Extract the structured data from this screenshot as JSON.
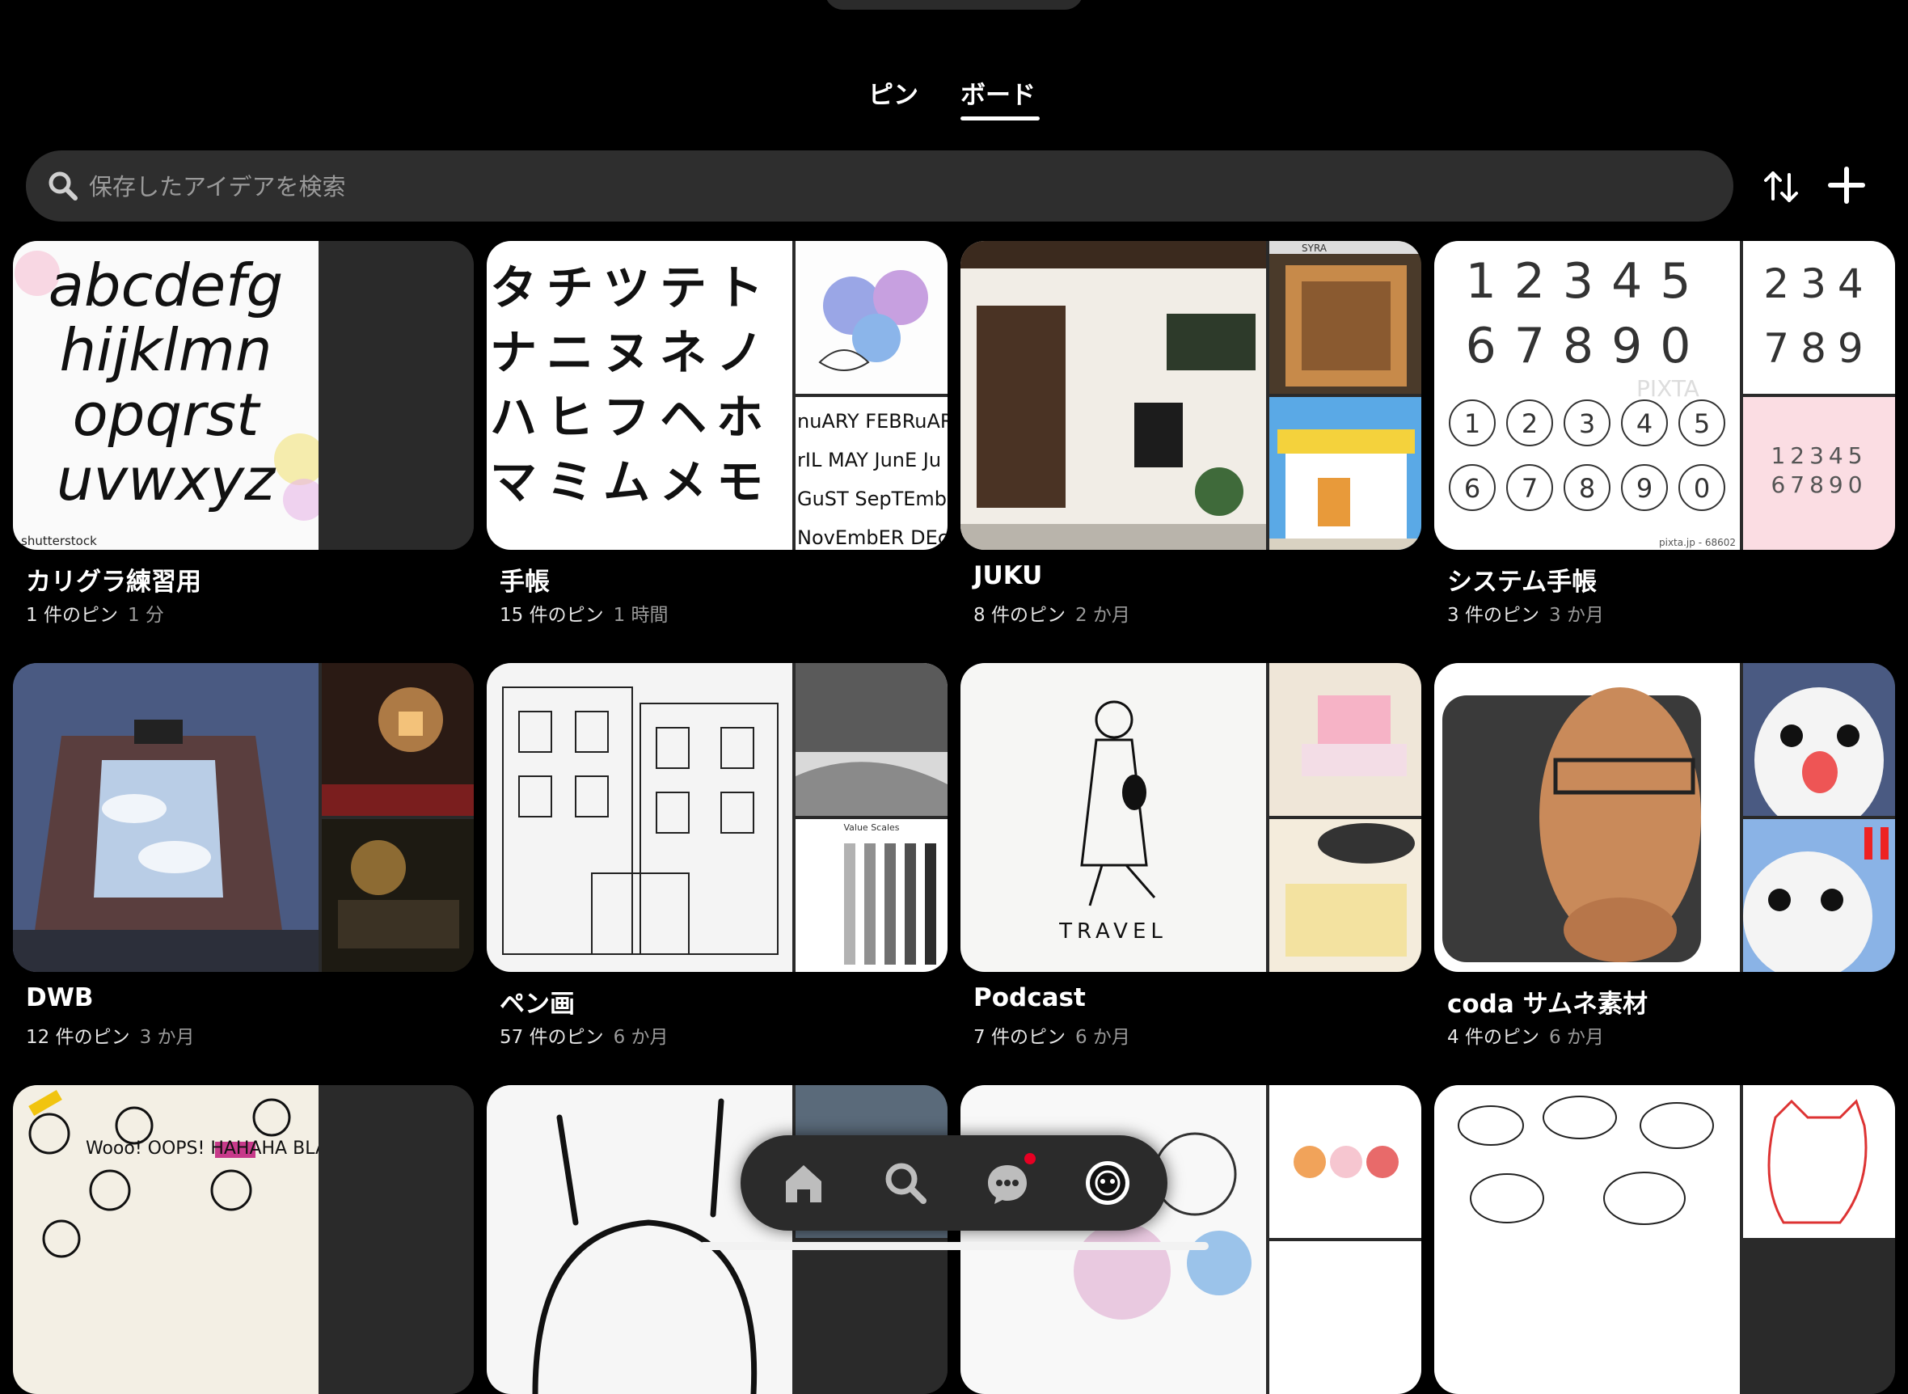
{
  "tabs": [
    {
      "label": "ピン",
      "active": false
    },
    {
      "label": "ボード",
      "active": true
    }
  ],
  "search": {
    "placeholder": "保存したアイデアを検索",
    "value": ""
  },
  "toolbar": {
    "sort_icon": "sort-arrows-icon",
    "add_icon": "plus-icon"
  },
  "boards": [
    {
      "title": "カリグラ練習用",
      "pins": "1 件のピン",
      "age": "1 分",
      "cover_text": "abcdefg hijklmn opqrst uvw xyz",
      "watermark": "shutterstock"
    },
    {
      "title": "手帳",
      "pins": "15 件のピン",
      "age": "1 時間",
      "cover_text": "タチツテト ナニヌネノ ハヒフヘホ マミムメモ",
      "side_text": "JANUARY FEBRUARY MAY JUNE SEPTEMBER NOVEMBER DECEMBER"
    },
    {
      "title": "JUKU",
      "pins": "8 件のピン",
      "age": "2 か月",
      "sign": "SYRA"
    },
    {
      "title": "システム手帳",
      "pins": "3 件のピン",
      "age": "3 か月",
      "digits": "1 2 3 4 5 6 7 8 9 0",
      "watermark": "PIXTA",
      "credit": "pixta.jp - 68602"
    },
    {
      "title": "DWB",
      "pins": "12 件のピン",
      "age": "3 か月"
    },
    {
      "title": "ペン画",
      "pins": "57 件のピン",
      "age": "6 か月",
      "chart_title": "Value Scales"
    },
    {
      "title": "Podcast",
      "pins": "7 件のピン",
      "age": "6 か月",
      "cover_text": "TRAVEL"
    },
    {
      "title": "coda サムネ素材",
      "pins": "4 件のピン",
      "age": "6 か月"
    },
    {
      "title": "",
      "pins": "",
      "age": "",
      "cover_text": "Wooo! OOPS! HAHAHA BLAH OX"
    },
    {
      "title": "",
      "pins": "",
      "age": ""
    },
    {
      "title": "",
      "pins": "",
      "age": ""
    },
    {
      "title": "",
      "pins": "",
      "age": ""
    }
  ],
  "nav": [
    {
      "name": "home-icon"
    },
    {
      "name": "search-icon"
    },
    {
      "name": "chat-icon",
      "badge": true
    },
    {
      "name": "profile-icon"
    }
  ],
  "colors": {
    "background": "#000000",
    "surface": "#2e2e2e",
    "accent_badge": "#e60023",
    "text": "#ffffff",
    "subtext": "#9a9a9a"
  }
}
